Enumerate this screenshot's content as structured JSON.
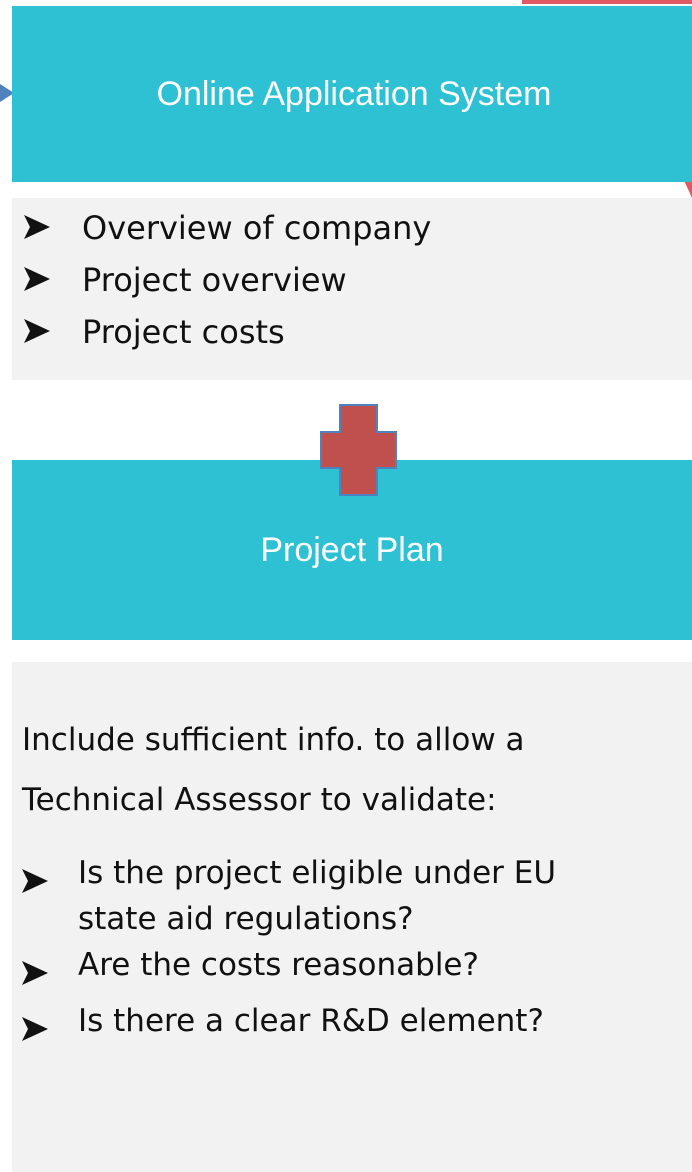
{
  "top_box": {
    "title": "Online Application System"
  },
  "first_list": {
    "items": [
      "Overview of company",
      "Project overview",
      "Project costs"
    ]
  },
  "second_box": {
    "title": "Project Plan"
  },
  "info_box": {
    "intro_line1": "Include sufficient info. to allow a",
    "intro_line2": "Technical Assessor to validate:",
    "items": [
      [
        "Is the project eligible under EU",
        "state aid regulations?"
      ],
      [
        "Are the costs reasonable?"
      ],
      [
        "Is there a clear R&D element?"
      ]
    ]
  },
  "colors": {
    "teal": "#2ec0d3",
    "grey_panel": "#f2f2f2",
    "plus_fill": "#c0504d",
    "plus_outline": "#4f81bd",
    "arrow_accent": "#4f81bd",
    "corner_accent": "#e05a64"
  },
  "icons": {
    "bullet": "arrowhead-bullet-icon",
    "connector": "plus-icon"
  }
}
